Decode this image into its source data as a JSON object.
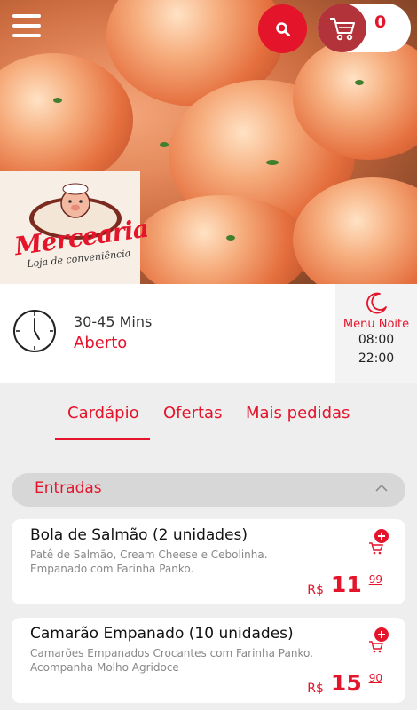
{
  "header": {
    "menu_icon": "hamburger-menu-icon",
    "search_icon": "search-icon",
    "cart_icon": "shopping-cart-icon",
    "cart_count": "0"
  },
  "store": {
    "logo_name": "Mercearia",
    "logo_tagline": "Loja de conveniência"
  },
  "info": {
    "delivery_time": "30-45 Mins",
    "status": "Aberto",
    "schedule_label": "Menu Noite",
    "schedule_open": "08:00",
    "schedule_close": "22:00"
  },
  "tabs": [
    {
      "label": "Cardápio",
      "active": true
    },
    {
      "label": "Ofertas",
      "active": false
    },
    {
      "label": "Mais pedidas",
      "active": false
    }
  ],
  "category": {
    "title": "Entradas",
    "expanded": true
  },
  "products": [
    {
      "name": "Bola de Salmão (2 unidades)",
      "description": "Patê de Salmão, Cream Cheese e Cebolinha. Empanado com Farinha Panko.",
      "currency": "R$",
      "price_int": "11",
      "price_cents": "99"
    },
    {
      "name": "Camarão Empanado (10 unidades)",
      "description": "Camarões Empanados Crocantes com Farinha Panko. Acompanha Molho Agridoce",
      "currency": "R$",
      "price_int": "15",
      "price_cents": "90"
    }
  ],
  "colors": {
    "accent": "#e4142b",
    "cart_circle": "#b3333a",
    "background": "#eeeeee"
  }
}
